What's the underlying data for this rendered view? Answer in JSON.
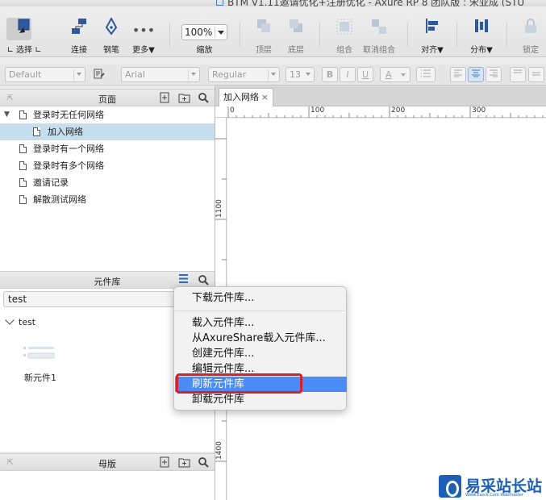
{
  "window": {
    "title": "BTM V1.11邀请优化+注册优化 - Axure RP 8 团队版 : 宋亚成 (STU"
  },
  "toolbar": {
    "select": "选择",
    "connect": "连接",
    "pen": "钢笔",
    "more": "更多▼",
    "zoom_value": "100%",
    "zoom_label": "缩放",
    "top_layer": "顶层",
    "bottom_layer": "底层",
    "group": "组合",
    "ungroup": "取消组合",
    "align": "对齐▼",
    "distribute": "分布▼",
    "lock": "锁定"
  },
  "format": {
    "style": "Default",
    "font": "Arial",
    "weight": "Regular",
    "size": "13",
    "bold": "B",
    "italic": "I",
    "underline": "U",
    "font_color": "A"
  },
  "pages": {
    "title": "页面",
    "items": [
      {
        "label": "登录时无任何网络"
      },
      {
        "label": "加入网络"
      },
      {
        "label": "登录时有一个网络"
      },
      {
        "label": "登录时有多个网络"
      },
      {
        "label": "邀请记录"
      },
      {
        "label": "解散测试网络"
      }
    ]
  },
  "library": {
    "title": "元件库",
    "selected": "test",
    "group": "test",
    "widget_label": "新元件1"
  },
  "masters": {
    "title": "母版"
  },
  "canvas": {
    "tab": "加入网络",
    "ruler_top": [
      "0",
      "100",
      "200",
      "300"
    ],
    "ruler_left": [
      "1100",
      "1400"
    ]
  },
  "menu": {
    "items": [
      "下载元件库...",
      "载入元件库...",
      "从AxureShare载入元件库...",
      "创建元件库...",
      "编辑元件库...",
      "刷新元件库",
      "卸载元件库"
    ],
    "highlighted": "刷新元件库"
  },
  "watermark": {
    "brand": "易采站长站",
    "sub": "Www.Easck.Com Webmaster"
  },
  "colors": {
    "highlight": "#4b8bf5",
    "annotation_box": "#d6202a",
    "selected_page": "#c5dfee"
  }
}
